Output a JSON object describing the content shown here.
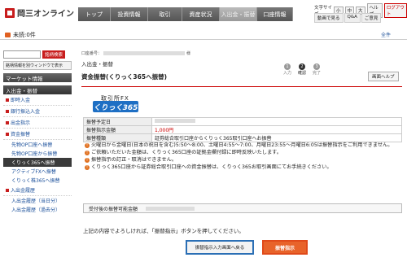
{
  "header": {
    "brand": "岡三オンライン",
    "nav_tabs": [
      "トップ",
      "投資情報",
      "取引",
      "資産状況",
      "入出金・振替",
      "口座情報"
    ],
    "fontsize_label": "文字サイズ",
    "fontsize_options": [
      "小",
      "中",
      "大"
    ],
    "help_label": "ヘルプ",
    "logout_label": "ログアウト",
    "util_links": [
      "動画で見る",
      "Q&A",
      "ご意見"
    ]
  },
  "unread": "未読:0件",
  "top_link": "全件",
  "sidebar": {
    "search_button": "銘柄検索",
    "window_link": "銘柄情報を別ウィンドウで表示",
    "market_head": "マーケット情報",
    "section_head": "入出金・振替",
    "items": [
      {
        "label": "即時入金"
      },
      {
        "label": "銀行振込入金"
      },
      {
        "label": "出金指示"
      },
      {
        "label": "資金振替"
      }
    ],
    "subitems": [
      {
        "label": "先物OP口座へ振替"
      },
      {
        "label": "先物OP口座から振替"
      },
      {
        "label": "くりっく365へ振替"
      },
      {
        "label": "アクティブFXへ振替"
      },
      {
        "label": "くりっく株365へ振替"
      }
    ],
    "items2": [
      {
        "label": "入出金履歴"
      }
    ],
    "subitems2": [
      {
        "label": "入出金履歴（当日分）"
      },
      {
        "label": "入出金履歴（過去分）"
      }
    ]
  },
  "main": {
    "account_label": "口座番号：",
    "account_suffix": "様",
    "breadcrumb": "入出金・振替",
    "page_title": "資金振替(くりっく365へ振替)",
    "steps": [
      {
        "num": "1",
        "label": "入力"
      },
      {
        "num": "2",
        "label": "確認"
      },
      {
        "num": "3",
        "label": "完了"
      }
    ],
    "help_button": "画面ヘルプ",
    "bank_label": "取引所FX",
    "bank_logo": "くりっく365",
    "table": [
      {
        "key": "振替予定日",
        "value": ""
      },
      {
        "key": "振替指示金額",
        "value": "1,000円"
      },
      {
        "key": "振替種類",
        "value": "証券総合取引口座からくりっく365取引口座へお振替"
      }
    ],
    "notes": [
      "火曜日から金曜日(日本の祝日を含む)5:50～8:00、土曜日4:55～7:00、月曜日23:55～月曜日6:05は振替指示をご利用できません。",
      "ご依頼いただいた金額は、くりっく365口座の証拠金欄付録に即時反映いたします。",
      "振替指示の訂正・取消はできません。",
      "くりっく365口座から証券総合取引口座への資金振替は、くりっく365お取引画面にてお手続きください。"
    ],
    "available_label": "受付後の振替可能金額",
    "instruction": "上記の内容でよろしければ、「振替指示」ボタンを押してください。",
    "back_button": "振替指示入力画面へ戻る",
    "submit_button": "振替指示"
  }
}
